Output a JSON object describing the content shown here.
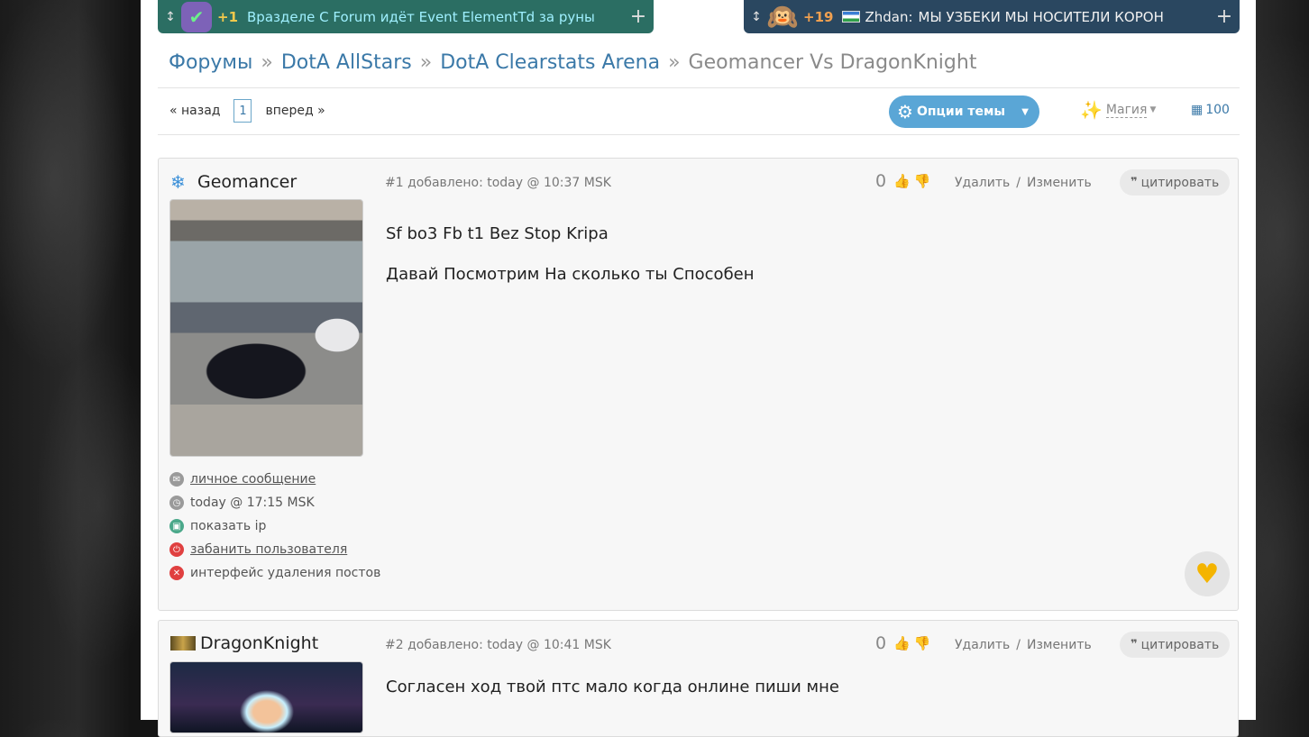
{
  "notices": [
    {
      "plus": "+1",
      "text": "Вразделе C Forum идёт Event ElementTd за руны",
      "avatar_icon": "shield-check-icon",
      "add": "+"
    },
    {
      "plus": "+19",
      "user": "Zhdan:",
      "text": "МЫ УЗБЕКИ МЫ НОСИТЕЛИ КОРОН",
      "avatar_icon": "monkey-icon",
      "add": "+"
    }
  ],
  "breadcrumbs": [
    {
      "label": "Форумы",
      "link": true
    },
    {
      "label": "DotA AllStars",
      "link": true
    },
    {
      "label": "DotA Clearstats Arena",
      "link": true
    },
    {
      "label": "Geomancer Vs DragonKnight",
      "link": false
    }
  ],
  "breadcrumb_sep": "»",
  "pager": {
    "prev": "« назад",
    "current": "1",
    "next": "вперед »"
  },
  "toolbar": {
    "options_label": "Опции темы",
    "magic_label": "Магия",
    "count": "100"
  },
  "posts": [
    {
      "author": "Geomancer",
      "header": "#1 добавлено: today @ 10:37 MSK",
      "votes": "0",
      "delete": "Удалить",
      "slash": "/",
      "edit": "Изменить",
      "quote": "цитировать",
      "lines": [
        "Sf bo3 Fb t1 Bez Stop Kripa",
        "Давай Посмотрим На сколько ты Способен"
      ],
      "meta": [
        {
          "label": "личное сообщение",
          "icon": "mail-icon",
          "color": "#9a9a9a",
          "underline": true
        },
        {
          "label": "today @ 17:15 MSK",
          "icon": "clock-icon",
          "color": "#9a9a9a",
          "underline": false
        },
        {
          "label": "показать ip",
          "icon": "ip-icon",
          "color": "#4aa88a",
          "underline": false
        },
        {
          "label": "забанить пользователя",
          "icon": "power-icon",
          "color": "#e04040",
          "underline": true
        },
        {
          "label": "интерфейс удаления постов",
          "icon": "close-icon",
          "color": "#e04040",
          "underline": false
        }
      ]
    },
    {
      "author": "DragonKnight",
      "header": "#2 добавлено: today @ 10:41 MSK",
      "votes": "0",
      "delete": "Удалить",
      "slash": "/",
      "edit": "Изменить",
      "quote": "цитировать",
      "lines": [
        "Согласен ход твой птс мало когда онлине пиши мне"
      ]
    }
  ],
  "colors": {
    "link": "#3b79a8",
    "options_bg": "#5aa6d6",
    "notice_left": "#2b6e63",
    "notice_right": "#2a4760"
  }
}
